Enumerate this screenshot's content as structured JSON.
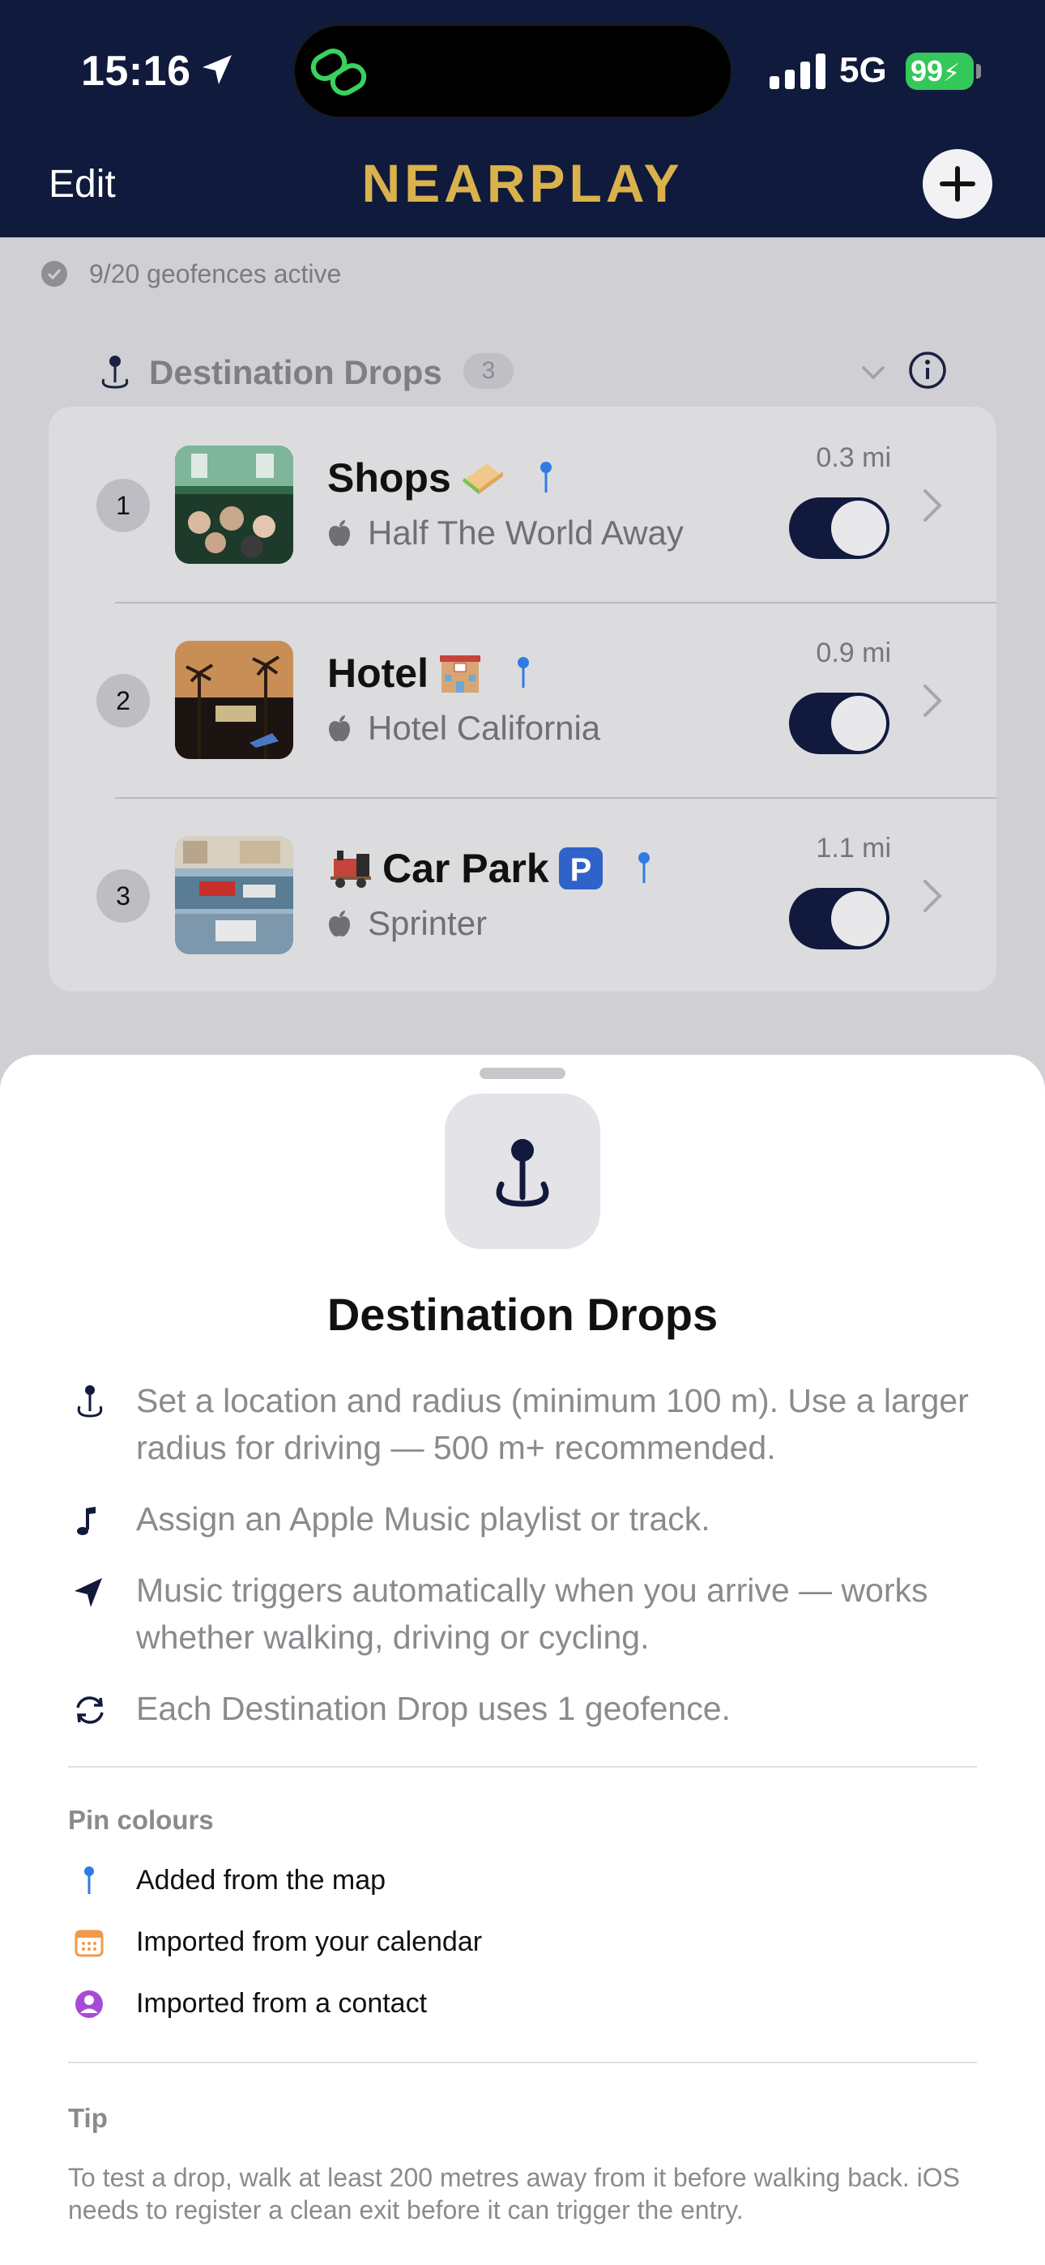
{
  "status_bar": {
    "time": "15:16",
    "network": "5G",
    "battery": "99"
  },
  "header": {
    "edit_label": "Edit",
    "app_title": "NEARPLAY"
  },
  "geofence_status": "9/20 geofences active",
  "section": {
    "title": "Destination Drops",
    "count": "3"
  },
  "drops": [
    {
      "index": "1",
      "name": "Shops",
      "emoji": "sandwich",
      "track": "Half The World Away",
      "distance": "0.3 mi",
      "enabled": true
    },
    {
      "index": "2",
      "name": "Hotel",
      "emoji": "hotel",
      "track": "Hotel California",
      "distance": "0.9 mi",
      "enabled": true
    },
    {
      "index": "3",
      "name": "Car Park",
      "emoji": "train-and-parking",
      "track": "Sprinter",
      "distance": "1.1 mi",
      "enabled": true
    }
  ],
  "sheet": {
    "title": "Destination Drops",
    "bullets": [
      {
        "icon": "pin-icon",
        "text": "Set a location and radius (minimum 100 m). Use a larger radius for driving — 500 m+ recommended."
      },
      {
        "icon": "music-note-icon",
        "text": "Assign an Apple Music playlist or track."
      },
      {
        "icon": "location-arrow-icon",
        "text": "Music triggers automatically when you arrive — works whether walking, driving or cycling."
      },
      {
        "icon": "refresh-icon",
        "text": "Each Destination Drop uses 1 geofence."
      }
    ],
    "pin_colours_label": "Pin colours",
    "pin_colours": [
      {
        "icon": "blue-pin-icon",
        "text": "Added from the map",
        "color": "#2f7be5"
      },
      {
        "icon": "calendar-icon",
        "text": "Imported from your calendar",
        "color": "#f2994a"
      },
      {
        "icon": "contact-icon",
        "text": "Imported from a contact",
        "color": "#a64bd6"
      }
    ],
    "tip_label": "Tip",
    "tip_text": "To test a drop, walk at least 200 metres away from it before walking back. iOS needs to register a clean exit before it can trigger the entry."
  },
  "colors": {
    "header_bg": "#101a3c",
    "logo": "#d9b24c",
    "toggle_on": "#111a3d",
    "battery": "#34c759"
  }
}
